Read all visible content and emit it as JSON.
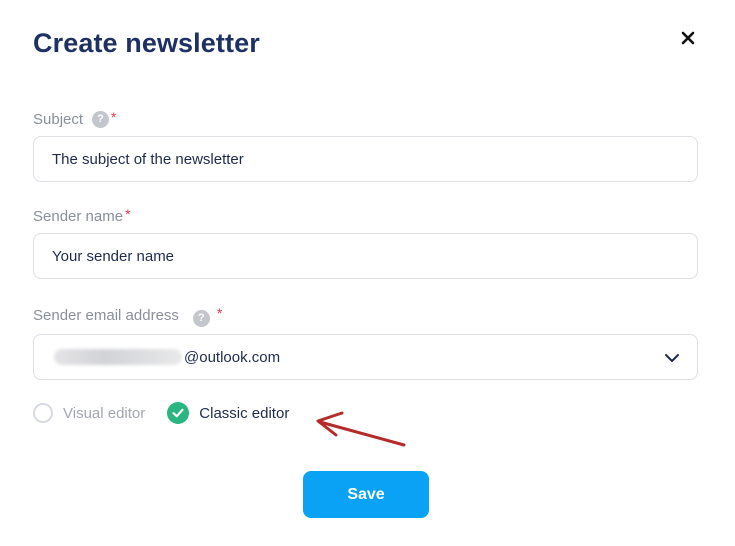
{
  "modal": {
    "title": "Create newsletter",
    "close_icon": "close-icon"
  },
  "subject": {
    "label": "Subject",
    "help_glyph": "?",
    "required_mark": "*",
    "value": "The subject of the newsletter"
  },
  "sender_name": {
    "label": "Sender name",
    "required_mark": "*",
    "value": "Your sender name"
  },
  "sender_email": {
    "label": "Sender email address",
    "help_glyph": "?",
    "required_mark": "*",
    "value_domain": "@outlook.com",
    "dropdown_icon": "chevron-down-icon"
  },
  "editor_options": [
    {
      "label": "Visual editor",
      "selected": false
    },
    {
      "label": "Classic editor",
      "selected": true
    }
  ],
  "save_label": "Save",
  "colors": {
    "title": "#1f3163",
    "accent_button": "#0aa2f5",
    "selected_radio": "#2bb580",
    "required": "#e8364c",
    "annotation_arrow": "#b52a2a"
  }
}
